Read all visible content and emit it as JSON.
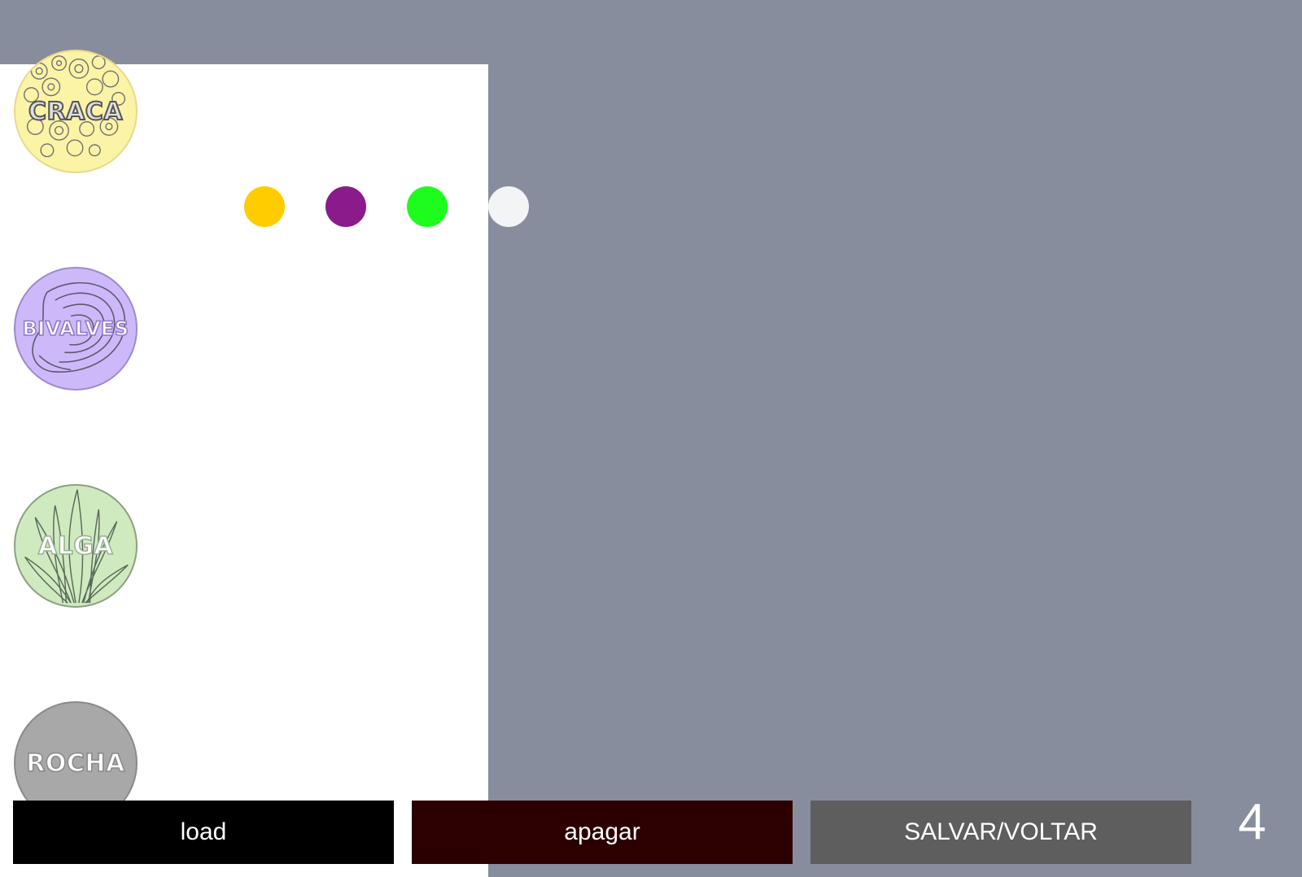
{
  "species": [
    {
      "id": "craca",
      "label": "CRACA",
      "icon": "barnacle-icon",
      "color": "#fbf3a6"
    },
    {
      "id": "bivalves",
      "label": "BIVALVES",
      "icon": "oyster-icon",
      "color": "#cdb8fa"
    },
    {
      "id": "alga",
      "label": "ALGA",
      "icon": "seaweed-icon",
      "color": "#d0eac0"
    },
    {
      "id": "rocha",
      "label": "ROCHA",
      "icon": "rock-icon",
      "color": "#a8a8a8"
    }
  ],
  "palette": [
    "#ffcc00",
    "#8b1a8b",
    "#1dfc1d",
    "#f3f4f5"
  ],
  "buttons": {
    "load": "load",
    "apagar": "apagar",
    "salvar": "SALVAR/VOLTAR"
  },
  "counter": "4"
}
